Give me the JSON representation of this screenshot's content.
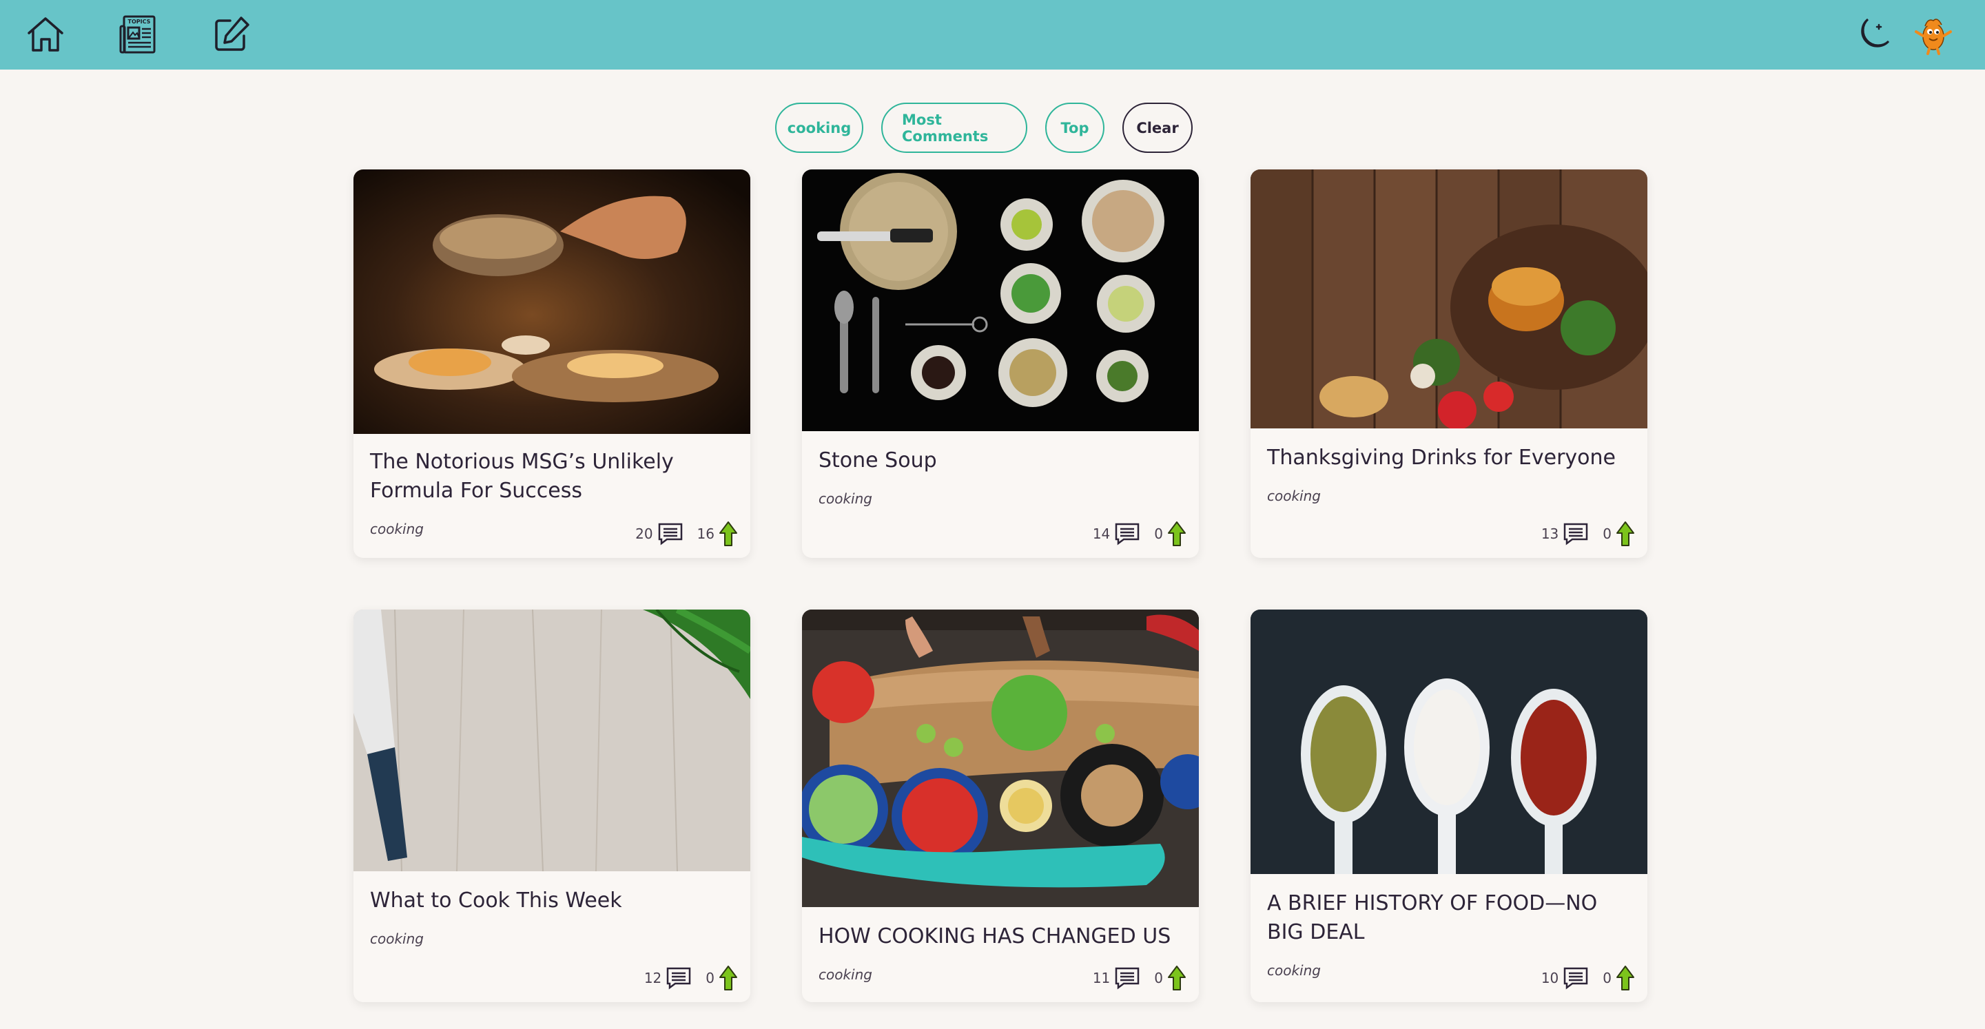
{
  "nav": {
    "home_icon": "home-icon",
    "topics_icon": "topics-newspaper-icon",
    "topics_label": "TOPICS",
    "post_icon": "edit-icon",
    "theme_icon": "moon-icon",
    "avatar_icon": "avatar-icon"
  },
  "filters": {
    "topic": "cooking",
    "most_comments": "Most Comments",
    "top": "Top",
    "clear": "Clear"
  },
  "colors": {
    "topbar": "#67c4c8",
    "accent": "#2fb59a",
    "background": "#f8f5f2",
    "upvote": "#7cc41c"
  },
  "articles": [
    {
      "title": "The Notorious MSG’s Unlikely Formula For Success",
      "topic": "cooking",
      "comments": "20",
      "votes": "16",
      "image": "chef-cooking-dark-kitchen"
    },
    {
      "title": "Stone Soup",
      "topic": "cooking",
      "comments": "14",
      "votes": "0",
      "image": "knife-bowls-ingredients-black-background"
    },
    {
      "title": "Thanksgiving Drinks for Everyone",
      "topic": "cooking",
      "comments": "13",
      "votes": "0",
      "image": "burger-on-wooden-table"
    },
    {
      "title": "What to Cook This Week",
      "topic": "cooking",
      "comments": "12",
      "votes": "0",
      "image": "knife-on-wooden-board-with-leaves"
    },
    {
      "title": "HOW COOKING HAS CHANGED US",
      "topic": "cooking",
      "comments": "11",
      "votes": "0",
      "image": "hands-chopping-vegetables"
    },
    {
      "title": "A BRIEF HISTORY OF FOOD—NO BIG DEAL",
      "topic": "cooking",
      "comments": "10",
      "votes": "0",
      "image": "spoons-with-spices"
    }
  ]
}
